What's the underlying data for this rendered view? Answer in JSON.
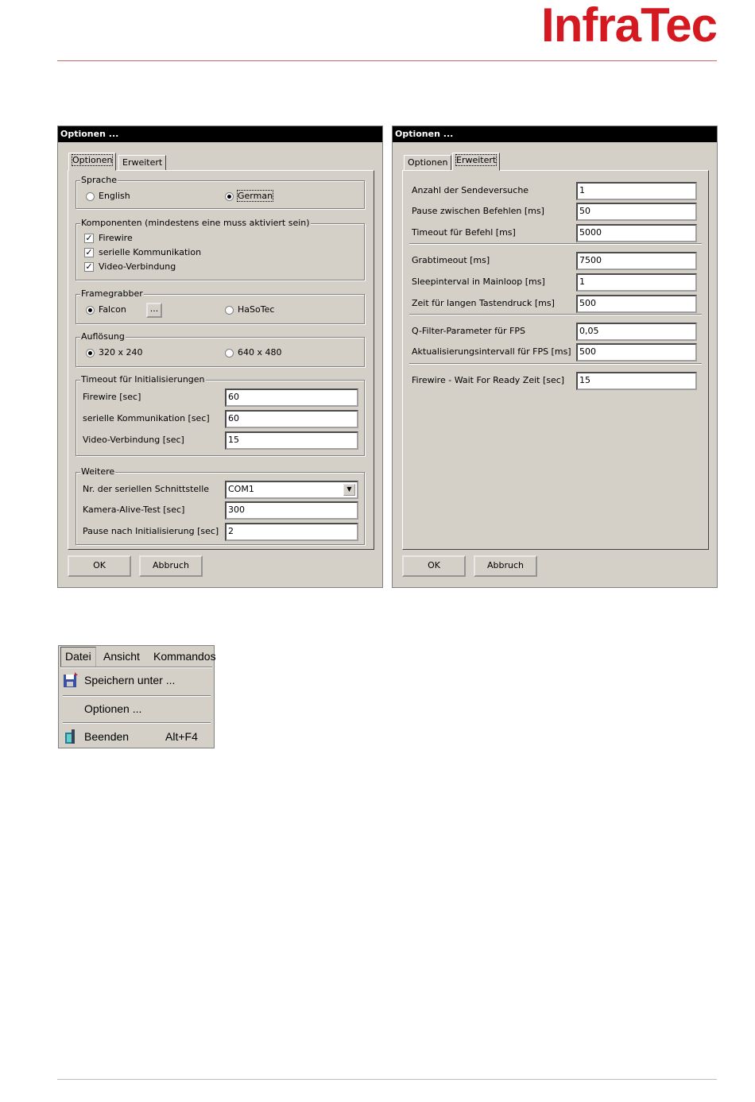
{
  "logo": {
    "infra": "Infra",
    "tec": "Tec"
  },
  "dialog1": {
    "title": "Optionen ...",
    "tabs": [
      "Optionen",
      "Erweitert"
    ],
    "sprache": {
      "label": "Sprache",
      "english": "English",
      "german": "German",
      "selected": "German"
    },
    "komponenten": {
      "label": "Komponenten (mindestens eine muss aktiviert sein)",
      "items": [
        {
          "label": "Firewire",
          "checked": true
        },
        {
          "label": "serielle Kommunikation",
          "checked": true
        },
        {
          "label": "Video-Verbindung",
          "checked": true
        }
      ]
    },
    "framegrabber": {
      "label": "Framegrabber",
      "falcon": "Falcon",
      "browse": "...",
      "hasotec": "HaSoTec",
      "selected": "Falcon"
    },
    "aufloesung": {
      "label": "Auflösung",
      "r1": "320 x 240",
      "r2": "640 x 480",
      "selected": "320 x 240"
    },
    "timeout": {
      "label": "Timeout für Initialisierungen",
      "firewire_label": "Firewire [sec]",
      "firewire_value": "60",
      "seriell_label": "serielle Kommunikation [sec]",
      "seriell_value": "60",
      "video_label": "Video-Verbindung [sec]",
      "video_value": "15"
    },
    "weitere": {
      "label": "Weitere",
      "port_label": "Nr. der seriellen Schnittstelle",
      "port_value": "COM1",
      "alive_label": "Kamera-Alive-Test [sec]",
      "alive_value": "300",
      "pause_label": "Pause nach Initialisierung [sec]",
      "pause_value": "2"
    },
    "ok": "OK",
    "cancel": "Abbruch"
  },
  "dialog2": {
    "title": "Optionen ...",
    "tabs": [
      "Optionen",
      "Erweitert"
    ],
    "rows": [
      {
        "label": "Anzahl der Sendeversuche",
        "value": "1"
      },
      {
        "label": "Pause zwischen Befehlen [ms]",
        "value": "50"
      },
      {
        "label": "Timeout für Befehl [ms]",
        "value": "5000"
      },
      {
        "label": "Grabtimeout [ms]",
        "value": "7500"
      },
      {
        "label": "Sleepinterval in Mainloop [ms]",
        "value": "1"
      },
      {
        "label": "Zeit für langen Tastendruck [ms]",
        "value": "500"
      },
      {
        "label": "Q-Filter-Parameter für FPS",
        "value": "0,05"
      },
      {
        "label": "Aktualisierungsintervall für FPS [ms]",
        "value": "500"
      },
      {
        "label": "Firewire - Wait For Ready Zeit [sec]",
        "value": "15"
      }
    ],
    "ok": "OK",
    "cancel": "Abbruch"
  },
  "menu": {
    "bar": [
      "Datei",
      "Ansicht",
      "Kommandos"
    ],
    "items": [
      {
        "label": "Speichern unter ...",
        "icon": "save-icon"
      },
      {
        "label": "Optionen ..."
      },
      {
        "label": "Beenden",
        "shortcut": "Alt+F4",
        "icon": "exit-icon"
      }
    ]
  }
}
